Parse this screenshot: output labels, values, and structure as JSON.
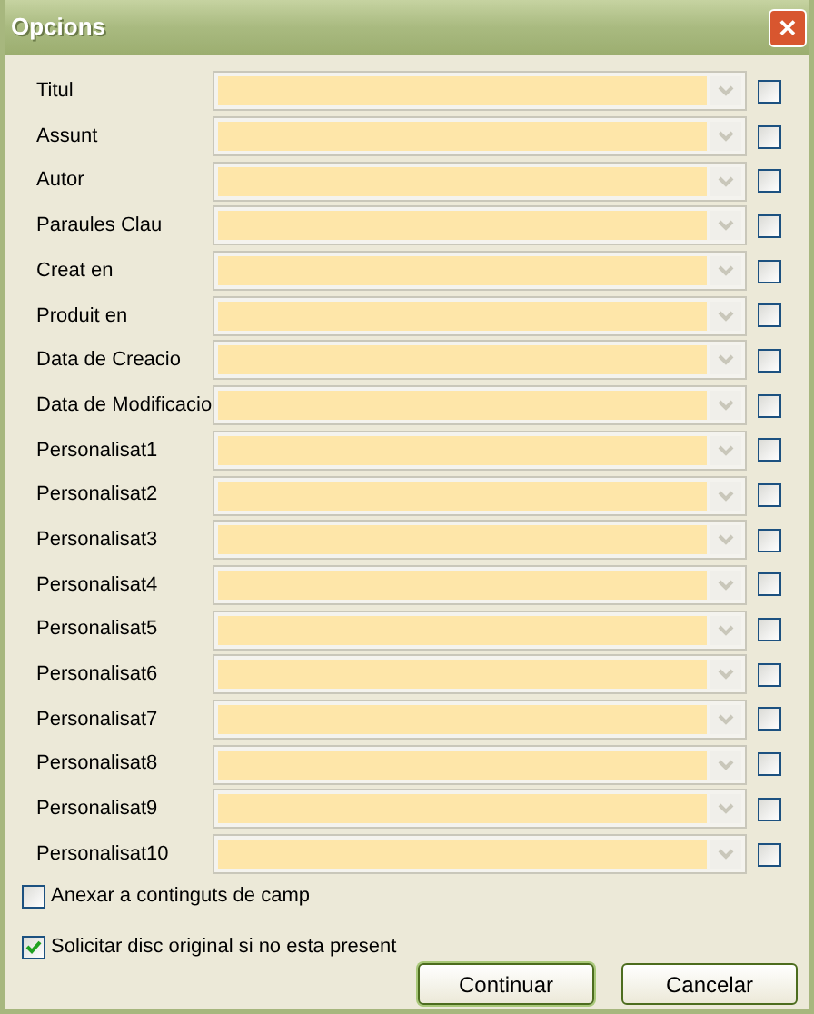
{
  "window": {
    "title": "Opcions",
    "close": "✕"
  },
  "fields": [
    {
      "label": "Titul",
      "disabled": true,
      "checked": false
    },
    {
      "label": "Assunt",
      "disabled": true,
      "checked": false
    },
    {
      "label": "Autor",
      "disabled": true,
      "checked": false
    },
    {
      "label": "Paraules Clau",
      "disabled": true,
      "checked": false
    },
    {
      "label": "Creat en",
      "disabled": true,
      "checked": false
    },
    {
      "label": "Produit en",
      "disabled": true,
      "checked": false
    },
    {
      "label": "Data de Creacio",
      "disabled": true,
      "checked": false
    },
    {
      "label": "Data de Modificacio",
      "disabled": true,
      "checked": false
    },
    {
      "label": "Personalisat1",
      "disabled": true,
      "checked": false
    },
    {
      "label": "Personalisat2",
      "disabled": true,
      "checked": false
    },
    {
      "label": "Personalisat3",
      "disabled": true,
      "checked": false
    },
    {
      "label": "Personalisat4",
      "disabled": true,
      "checked": false
    },
    {
      "label": "Personalisat5",
      "disabled": true,
      "checked": false
    },
    {
      "label": "Personalisat6",
      "disabled": true,
      "checked": false
    },
    {
      "label": "Personalisat7",
      "disabled": true,
      "checked": false
    },
    {
      "label": "Personalisat8",
      "disabled": true,
      "checked": false
    },
    {
      "label": "Personalisat9",
      "disabled": true,
      "checked": false
    },
    {
      "label": "Personalisat10",
      "disabled": true,
      "checked": false
    }
  ],
  "options": [
    {
      "label": "Anexar a continguts de camp",
      "checked": false
    },
    {
      "label": "Solicitar disc original si no esta present",
      "checked": true
    }
  ],
  "buttons": [
    {
      "label": "Continuar",
      "default": true
    },
    {
      "label": "Cancelar",
      "default": false
    }
  ]
}
